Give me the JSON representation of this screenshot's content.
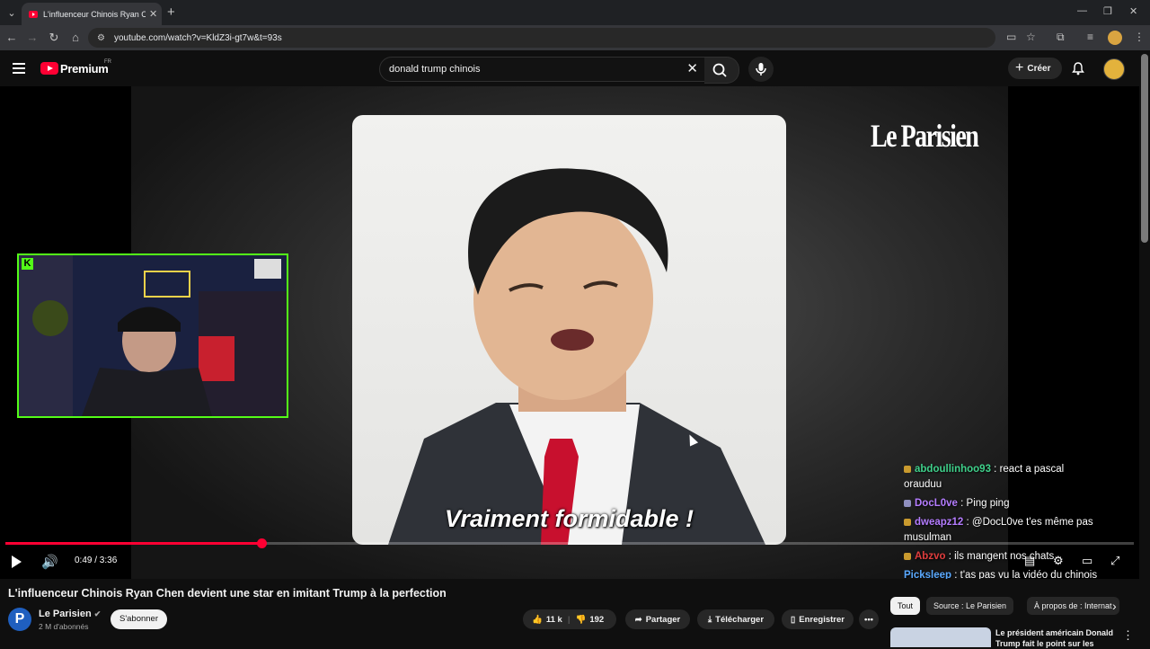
{
  "browser": {
    "tab_title": "L'influenceur Chinois Ryan Chen",
    "tab_close": "✕",
    "new_tab": "+",
    "url": "youtube.com/watch?v=KldZ3i-gt7w&t=93s",
    "window": {
      "minimize": "—",
      "restore": "❐",
      "close": "✕"
    }
  },
  "header": {
    "brand": "Premium",
    "region": "FR",
    "search_query": "donald trump chinois",
    "clear_icon": "✕",
    "create_label": "Créer"
  },
  "video": {
    "watermark": "Le Parisien",
    "subtitle": "Vraiment formidable !",
    "current_time": "0:49",
    "duration": "3:36",
    "time_display": "0:49 / 3:36",
    "progress": 0.227
  },
  "chat": [
    {
      "user": "abdoullinhoo93",
      "text": " : react a pascal orauduu",
      "color": "#3fd18b"
    },
    {
      "user": "DocL0ve",
      "text": " : Ping ping",
      "color": "#b47cff"
    },
    {
      "user": "dweapz12",
      "text": " : @DocL0ve t'es même pas musulman",
      "color": "#b47cff"
    },
    {
      "user": "Abzvo",
      "text": " : ils mangent nos chats",
      "color": "#e03d3d"
    },
    {
      "user": "Picksleep",
      "text": " : t'as pas vu la vidéo du chinois qui dit que les noirs ne sont pas des humains en Chine",
      "color": "#5aa9ff"
    }
  ],
  "details": {
    "title": "L'influenceur Chinois Ryan Chen devient une star en imitant Trump à la perfection",
    "channel": "Le Parisien",
    "verified": "✔",
    "subscribers": "2 M d'abonnés",
    "subscribe_label": "S'abonner",
    "likes": "11 k",
    "dislikes": "192",
    "share_label": "Partager",
    "download_label": "Télécharger",
    "save_label": "Enregistrer",
    "more_label": "•••"
  },
  "sidebar": {
    "chips": [
      "Tout",
      "Source : Le Parisien",
      "À propos de : Internat"
    ],
    "next_icon": "›",
    "reco_title": "Le président américain Donald Trump fait le point sur les",
    "reco_more": "⋮"
  },
  "colors": {
    "accent": "#ff0033",
    "kick": "#53fc18"
  }
}
